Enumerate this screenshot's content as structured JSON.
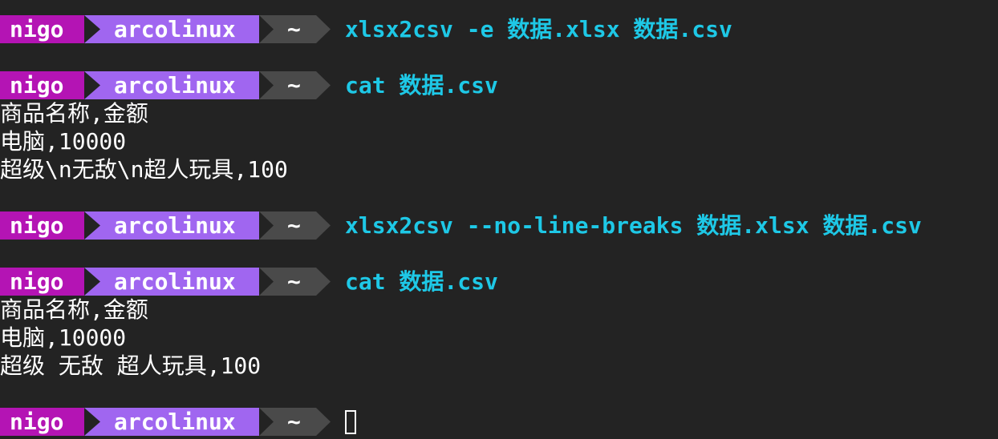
{
  "prompt": {
    "user": "nigo",
    "host": "arcolinux",
    "dir": "~"
  },
  "lines": {
    "cmd1": "xlsx2csv -e 数据.xlsx 数据.csv",
    "cmd2": "cat 数据.csv",
    "out2_1": "商品名称,金额",
    "out2_2": "电脑,10000",
    "out2_3": "超级\\n无敌\\n超人玩具,100",
    "cmd3": "xlsx2csv --no-line-breaks 数据.xlsx 数据.csv",
    "cmd4": "cat 数据.csv",
    "out4_1": "商品名称,金额",
    "out4_2": "电脑,10000",
    "out4_3": "超级 无敌 超人玩具,100"
  },
  "colors": {
    "background": "#232323",
    "user_segment": "#b414b4",
    "host_segment": "#a066f0",
    "dir_segment": "#4a4a4a",
    "command_text": "#1ec8e6",
    "output_text": "#ffffff"
  }
}
